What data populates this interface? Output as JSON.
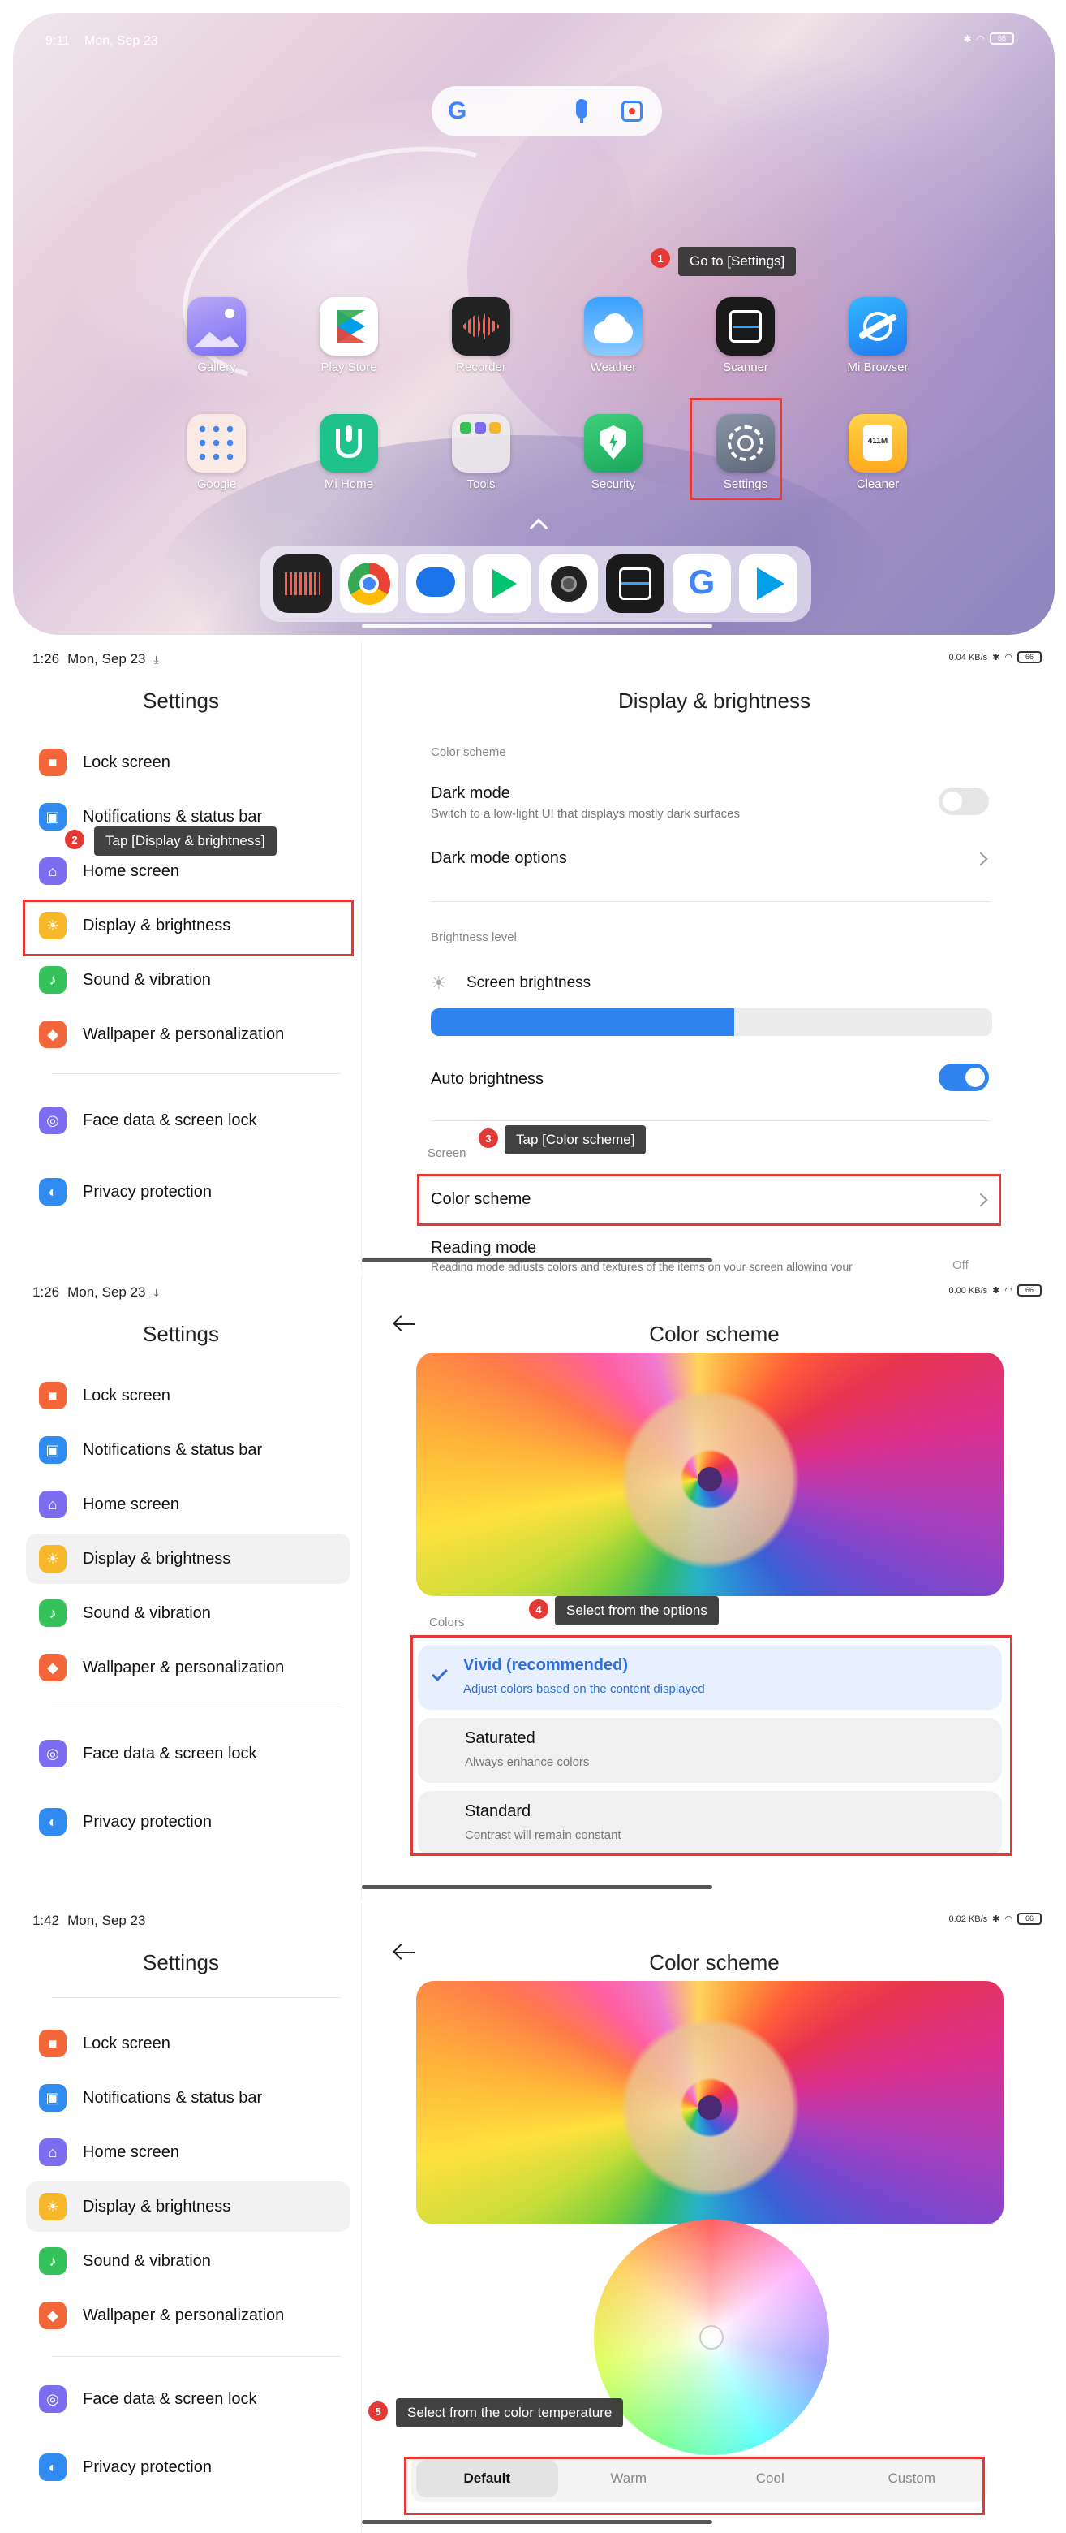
{
  "home": {
    "status_time": "9:11",
    "status_date": "Mon, Sep 23",
    "apps": [
      {
        "label": "Gallery",
        "icon": "gallery-icon"
      },
      {
        "label": "Play Store",
        "icon": "play-store-icon"
      },
      {
        "label": "Recorder",
        "icon": "recorder-icon"
      },
      {
        "label": "Weather",
        "icon": "weather-icon"
      },
      {
        "label": "Scanner",
        "icon": "scanner-icon"
      },
      {
        "label": "Mi Browser",
        "icon": "mi-browser-icon"
      },
      {
        "label": "Google",
        "icon": "google-folder-icon"
      },
      {
        "label": "Mi Home",
        "icon": "mi-home-icon"
      },
      {
        "label": "Tools",
        "icon": "tools-folder-icon"
      },
      {
        "label": "Security",
        "icon": "security-icon"
      },
      {
        "label": "Settings",
        "icon": "gear-icon"
      },
      {
        "label": "Cleaner",
        "icon": "cleaner-icon"
      }
    ],
    "cleaner_badge": "411M",
    "dock": [
      "recorder-icon",
      "chrome-icon",
      "messages-icon",
      "play-games-icon",
      "camera-icon",
      "scanner-icon",
      "google-icon",
      "play-store-icon"
    ]
  },
  "annotations": {
    "step1": {
      "num": "1",
      "text": "Go to [Settings]"
    },
    "step2": {
      "num": "2",
      "text": "Tap [Display & brightness]"
    },
    "step3": {
      "num": "3",
      "text": "Tap [Color scheme]"
    },
    "step4": {
      "num": "4",
      "text": "Select from the options"
    },
    "step5": {
      "num": "5",
      "text": "Select from the color temperature"
    }
  },
  "settings": {
    "title": "Settings",
    "items": [
      {
        "label": "Lock screen",
        "icon": "lock-icon",
        "color": "#f2663a"
      },
      {
        "label": "Notifications & status bar",
        "icon": "notification-icon",
        "color": "#2f8bf0"
      },
      {
        "label": "Home screen",
        "icon": "home-icon",
        "color": "#7b6cf0"
      },
      {
        "label": "Display & brightness",
        "icon": "sun-icon",
        "color": "#f6b72a"
      },
      {
        "label": "Sound & vibration",
        "icon": "speaker-icon",
        "color": "#36c25a"
      },
      {
        "label": "Wallpaper & personalization",
        "icon": "wallpaper-icon",
        "color": "#f2663a"
      },
      {
        "label": "Face data & screen lock",
        "icon": "face-lock-icon",
        "color": "#7b6cf0"
      },
      {
        "label": "Privacy protection",
        "icon": "privacy-icon",
        "color": "#2f8bf0"
      }
    ]
  },
  "panel2": {
    "status_time": "1:26",
    "status_date": "Mon, Sep 23",
    "status_speed": "0.04 KB/s",
    "title": "Display & brightness",
    "color_scheme_label": "Color scheme",
    "dark_mode_title": "Dark mode",
    "dark_mode_sub": "Switch to a low-light UI that displays mostly dark surfaces",
    "dark_mode_options": "Dark mode options",
    "brightness_label": "Brightness level",
    "screen_brightness": "Screen brightness",
    "brightness_level": 0.54,
    "auto_brightness": "Auto brightness",
    "screen_label": "Screen",
    "color_scheme_row": "Color scheme",
    "reading_mode": "Reading mode",
    "reading_mode_sub": "Reading mode adjusts colors and textures of the items on your screen allowing your",
    "reading_mode_value": "Off"
  },
  "panel3": {
    "status_time": "1:26",
    "status_date": "Mon, Sep 23",
    "status_speed": "0.00 KB/s",
    "title": "Color scheme",
    "colors_label": "Colors",
    "options": [
      {
        "title": "Vivid (recommended)",
        "sub": "Adjust colors based on the content displayed"
      },
      {
        "title": "Saturated",
        "sub": "Always enhance colors"
      },
      {
        "title": "Standard",
        "sub": "Contrast will remain constant"
      }
    ]
  },
  "panel4": {
    "status_time": "1:42",
    "status_date": "Mon, Sep 23",
    "status_speed": "0.02 KB/s",
    "title": "Color scheme",
    "segments": [
      "Default",
      "Warm",
      "Cool",
      "Custom"
    ],
    "selected_segment": "Default"
  },
  "battery": "66"
}
